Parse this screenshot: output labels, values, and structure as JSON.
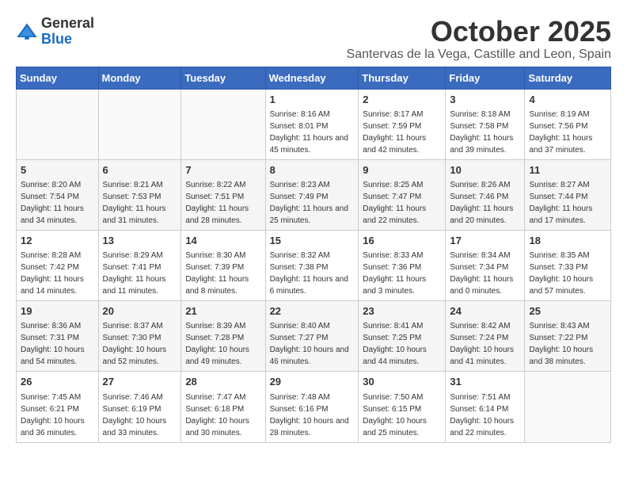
{
  "header": {
    "logo_general": "General",
    "logo_blue": "Blue",
    "month": "October 2025",
    "location": "Santervas de la Vega, Castille and Leon, Spain"
  },
  "weekdays": [
    "Sunday",
    "Monday",
    "Tuesday",
    "Wednesday",
    "Thursday",
    "Friday",
    "Saturday"
  ],
  "weeks": [
    [
      {
        "day": "",
        "info": ""
      },
      {
        "day": "",
        "info": ""
      },
      {
        "day": "",
        "info": ""
      },
      {
        "day": "1",
        "info": "Sunrise: 8:16 AM\nSunset: 8:01 PM\nDaylight: 11 hours and 45 minutes."
      },
      {
        "day": "2",
        "info": "Sunrise: 8:17 AM\nSunset: 7:59 PM\nDaylight: 11 hours and 42 minutes."
      },
      {
        "day": "3",
        "info": "Sunrise: 8:18 AM\nSunset: 7:58 PM\nDaylight: 11 hours and 39 minutes."
      },
      {
        "day": "4",
        "info": "Sunrise: 8:19 AM\nSunset: 7:56 PM\nDaylight: 11 hours and 37 minutes."
      }
    ],
    [
      {
        "day": "5",
        "info": "Sunrise: 8:20 AM\nSunset: 7:54 PM\nDaylight: 11 hours and 34 minutes."
      },
      {
        "day": "6",
        "info": "Sunrise: 8:21 AM\nSunset: 7:53 PM\nDaylight: 11 hours and 31 minutes."
      },
      {
        "day": "7",
        "info": "Sunrise: 8:22 AM\nSunset: 7:51 PM\nDaylight: 11 hours and 28 minutes."
      },
      {
        "day": "8",
        "info": "Sunrise: 8:23 AM\nSunset: 7:49 PM\nDaylight: 11 hours and 25 minutes."
      },
      {
        "day": "9",
        "info": "Sunrise: 8:25 AM\nSunset: 7:47 PM\nDaylight: 11 hours and 22 minutes."
      },
      {
        "day": "10",
        "info": "Sunrise: 8:26 AM\nSunset: 7:46 PM\nDaylight: 11 hours and 20 minutes."
      },
      {
        "day": "11",
        "info": "Sunrise: 8:27 AM\nSunset: 7:44 PM\nDaylight: 11 hours and 17 minutes."
      }
    ],
    [
      {
        "day": "12",
        "info": "Sunrise: 8:28 AM\nSunset: 7:42 PM\nDaylight: 11 hours and 14 minutes."
      },
      {
        "day": "13",
        "info": "Sunrise: 8:29 AM\nSunset: 7:41 PM\nDaylight: 11 hours and 11 minutes."
      },
      {
        "day": "14",
        "info": "Sunrise: 8:30 AM\nSunset: 7:39 PM\nDaylight: 11 hours and 8 minutes."
      },
      {
        "day": "15",
        "info": "Sunrise: 8:32 AM\nSunset: 7:38 PM\nDaylight: 11 hours and 6 minutes."
      },
      {
        "day": "16",
        "info": "Sunrise: 8:33 AM\nSunset: 7:36 PM\nDaylight: 11 hours and 3 minutes."
      },
      {
        "day": "17",
        "info": "Sunrise: 8:34 AM\nSunset: 7:34 PM\nDaylight: 11 hours and 0 minutes."
      },
      {
        "day": "18",
        "info": "Sunrise: 8:35 AM\nSunset: 7:33 PM\nDaylight: 10 hours and 57 minutes."
      }
    ],
    [
      {
        "day": "19",
        "info": "Sunrise: 8:36 AM\nSunset: 7:31 PM\nDaylight: 10 hours and 54 minutes."
      },
      {
        "day": "20",
        "info": "Sunrise: 8:37 AM\nSunset: 7:30 PM\nDaylight: 10 hours and 52 minutes."
      },
      {
        "day": "21",
        "info": "Sunrise: 8:39 AM\nSunset: 7:28 PM\nDaylight: 10 hours and 49 minutes."
      },
      {
        "day": "22",
        "info": "Sunrise: 8:40 AM\nSunset: 7:27 PM\nDaylight: 10 hours and 46 minutes."
      },
      {
        "day": "23",
        "info": "Sunrise: 8:41 AM\nSunset: 7:25 PM\nDaylight: 10 hours and 44 minutes."
      },
      {
        "day": "24",
        "info": "Sunrise: 8:42 AM\nSunset: 7:24 PM\nDaylight: 10 hours and 41 minutes."
      },
      {
        "day": "25",
        "info": "Sunrise: 8:43 AM\nSunset: 7:22 PM\nDaylight: 10 hours and 38 minutes."
      }
    ],
    [
      {
        "day": "26",
        "info": "Sunrise: 7:45 AM\nSunset: 6:21 PM\nDaylight: 10 hours and 36 minutes."
      },
      {
        "day": "27",
        "info": "Sunrise: 7:46 AM\nSunset: 6:19 PM\nDaylight: 10 hours and 33 minutes."
      },
      {
        "day": "28",
        "info": "Sunrise: 7:47 AM\nSunset: 6:18 PM\nDaylight: 10 hours and 30 minutes."
      },
      {
        "day": "29",
        "info": "Sunrise: 7:48 AM\nSunset: 6:16 PM\nDaylight: 10 hours and 28 minutes."
      },
      {
        "day": "30",
        "info": "Sunrise: 7:50 AM\nSunset: 6:15 PM\nDaylight: 10 hours and 25 minutes."
      },
      {
        "day": "31",
        "info": "Sunrise: 7:51 AM\nSunset: 6:14 PM\nDaylight: 10 hours and 22 minutes."
      },
      {
        "day": "",
        "info": ""
      }
    ]
  ]
}
